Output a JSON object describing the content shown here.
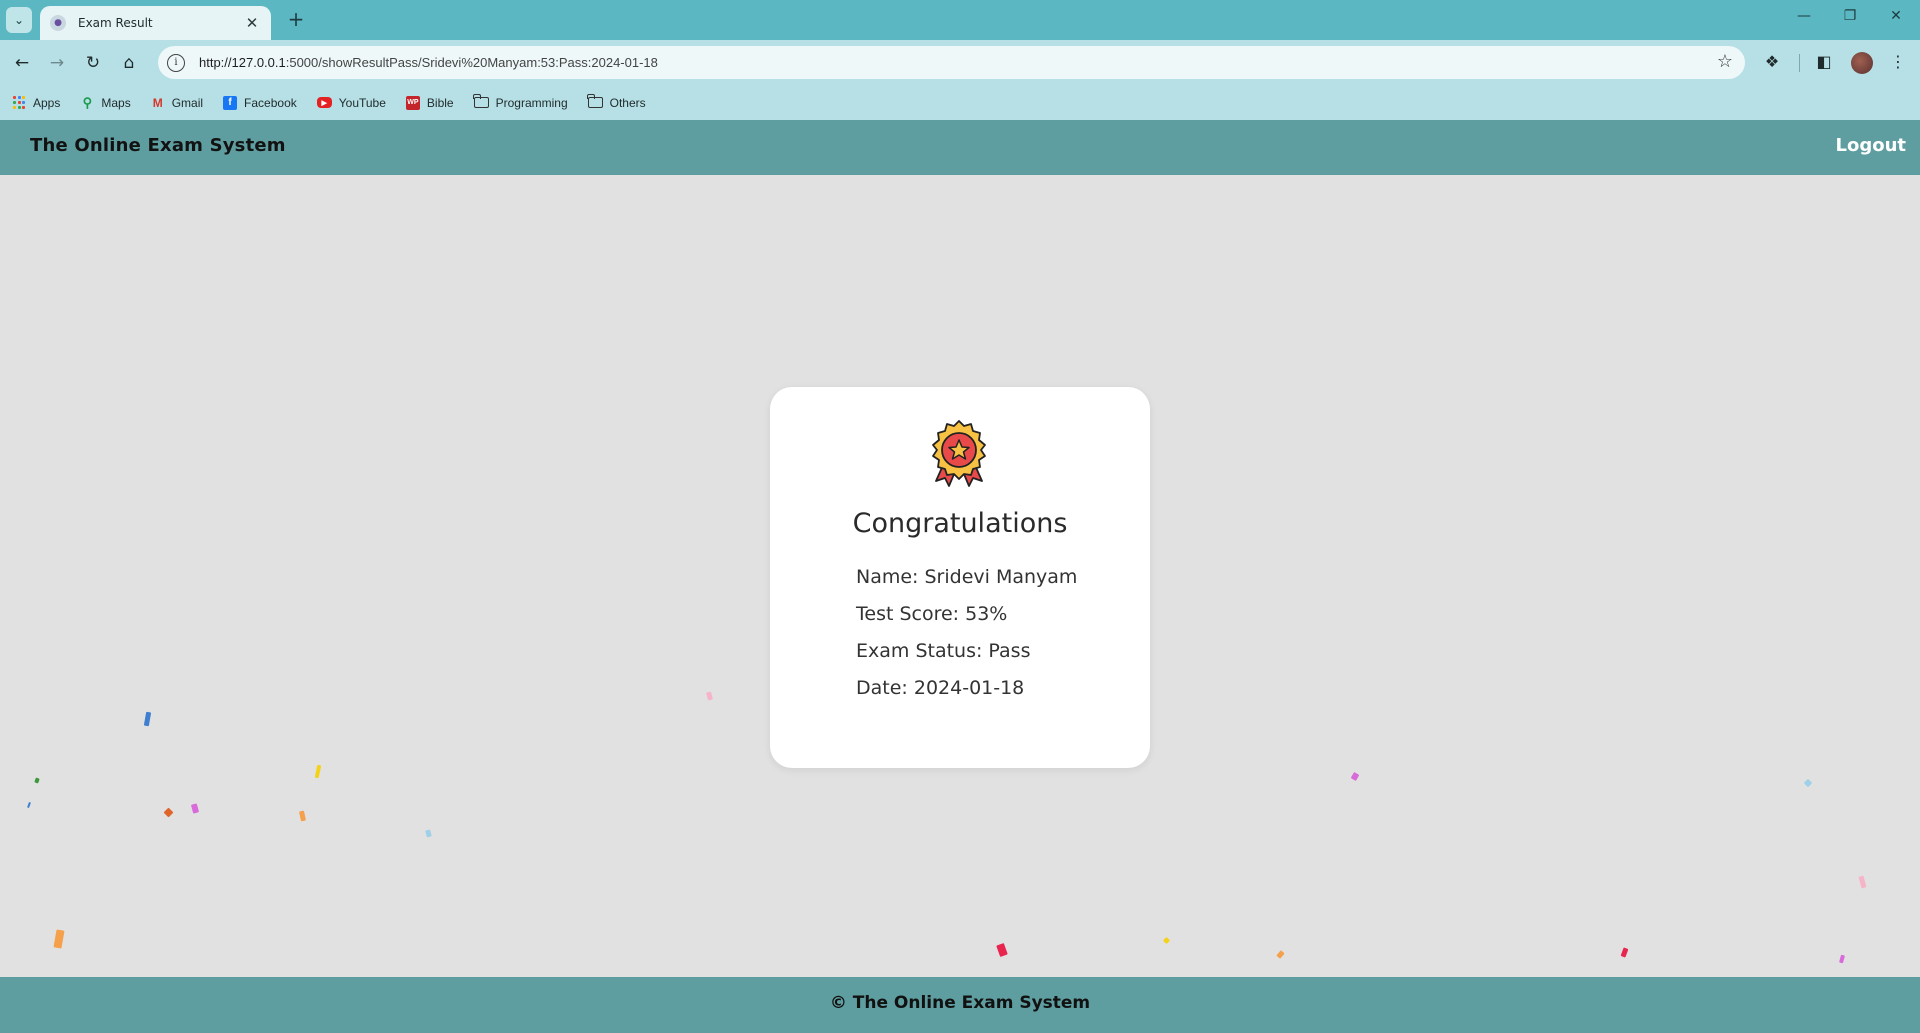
{
  "browser": {
    "tab_title": "Exam Result",
    "url_host": "http://127.0.0.1",
    "url_rest": ":5000/showResultPass/Sridevi%20Manyam:53:Pass:2024-01-18",
    "bookmarks": [
      {
        "label": "Apps",
        "icon": "apps-grid-icon"
      },
      {
        "label": "Maps",
        "icon": "maps-pin-icon"
      },
      {
        "label": "Gmail",
        "icon": "gmail-icon"
      },
      {
        "label": "Facebook",
        "icon": "facebook-icon"
      },
      {
        "label": "YouTube",
        "icon": "youtube-icon"
      },
      {
        "label": "Bible",
        "icon": "bible-icon"
      },
      {
        "label": "Programming",
        "icon": "folder-icon"
      },
      {
        "label": "Others",
        "icon": "folder-icon"
      }
    ]
  },
  "site": {
    "brand": "The Online Exam System",
    "logout": "Logout",
    "footer": "© The Online Exam System"
  },
  "result": {
    "title": "Congratulations",
    "name": "Name: Sridevi Manyam",
    "score": "Test Score: 53%",
    "status": "Exam Status: Pass",
    "date": "Date: 2024-01-18"
  },
  "colors": {
    "nav": "#5f9ea0",
    "page_bg": "#e1e1e1",
    "tab_strip": "#5bb8c2",
    "toolbar": "#b6e0e5"
  }
}
